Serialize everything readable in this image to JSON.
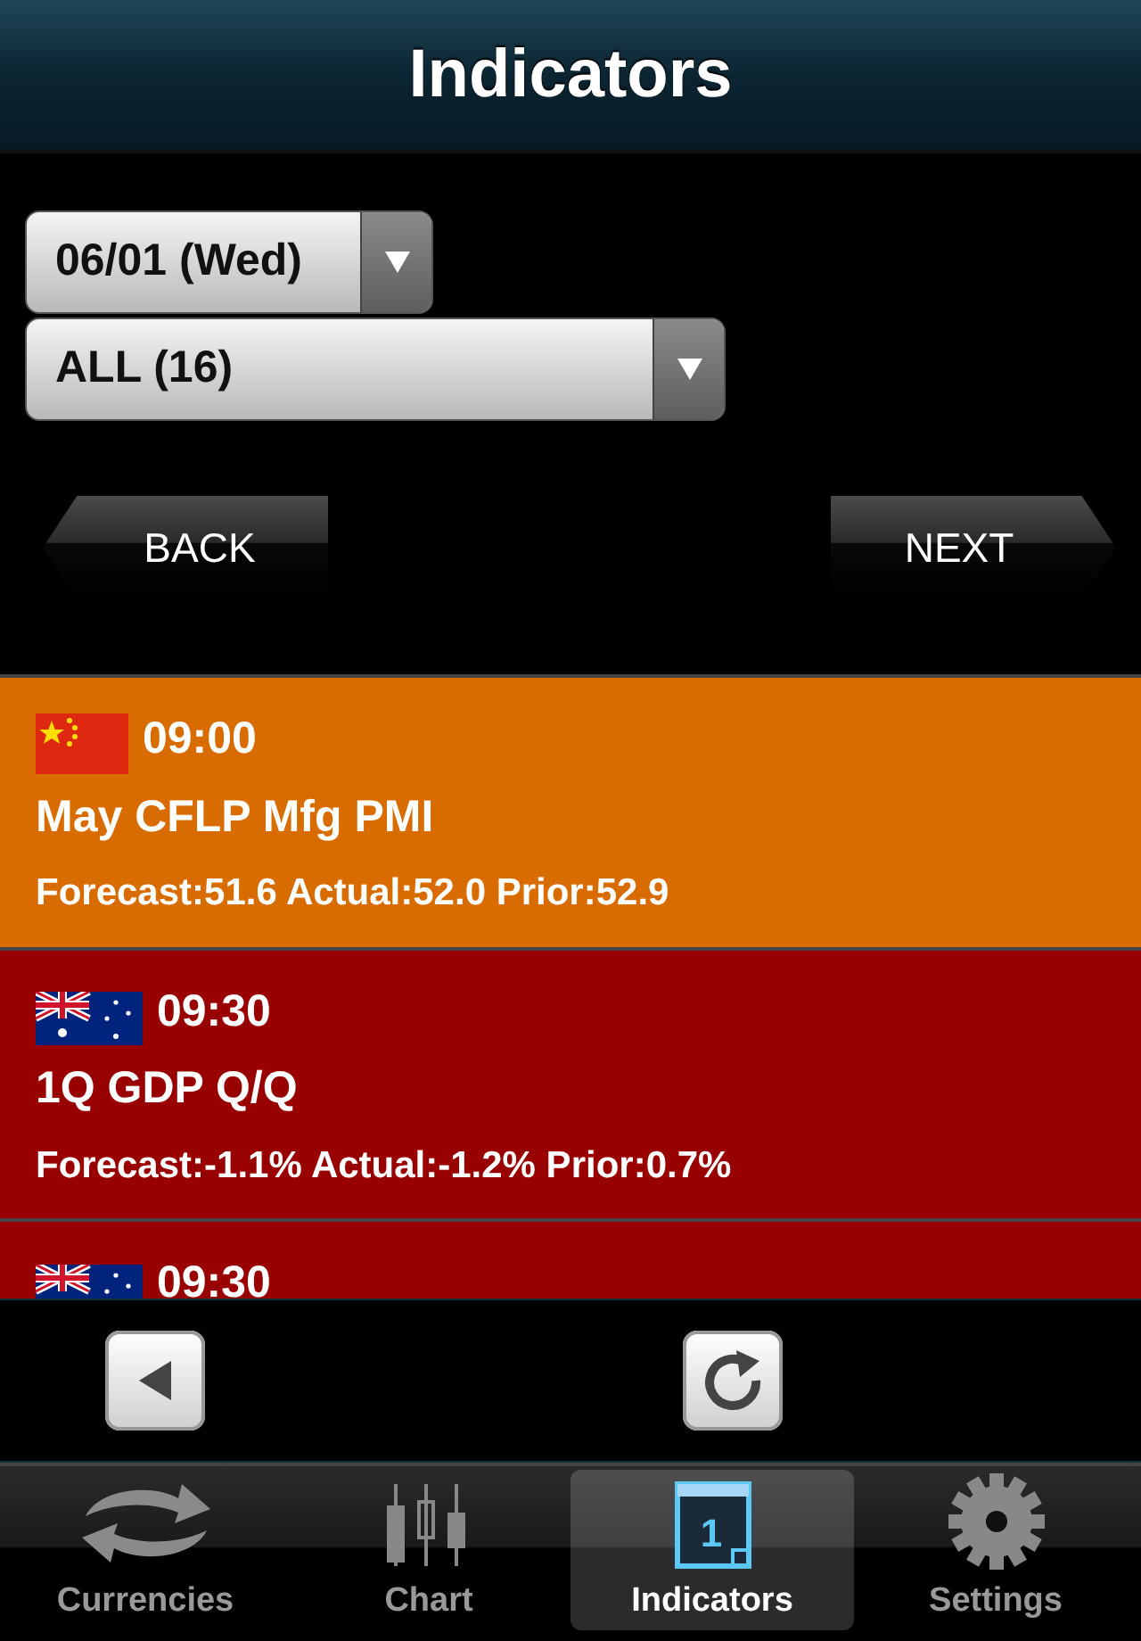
{
  "title": "Indicators",
  "date_select": {
    "value": "06/01 (Wed)"
  },
  "filter_select": {
    "value": "ALL (16)"
  },
  "back_button": "BACK",
  "next_button": "NEXT",
  "events": [
    {
      "kind": "cn",
      "time": "09:00",
      "name": "May CFLP Mfg PMI",
      "values": "Forecast:51.6 Actual:52.0 Prior:52.9",
      "color": "#d96c00"
    },
    {
      "kind": "au",
      "time": "09:30",
      "name": "1Q GDP Q/Q",
      "values": "Forecast:-1.1% Actual:-1.2% Prior:0.7%",
      "color": "#990000"
    },
    {
      "kind": "au",
      "time": "09:30",
      "color": "#990000"
    }
  ],
  "tabs": [
    {
      "kind": "currencies",
      "label": "Currencies",
      "selected": false
    },
    {
      "kind": "chart",
      "label": "Chart",
      "selected": false
    },
    {
      "kind": "indicators",
      "label": "Indicators",
      "selected": true,
      "day": "1"
    },
    {
      "kind": "settings",
      "label": "Settings",
      "selected": false
    }
  ]
}
